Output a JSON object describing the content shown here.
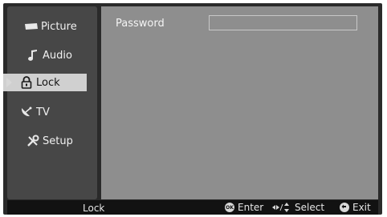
{
  "sidebar": {
    "items": [
      {
        "label": "Picture",
        "icon": "picture-icon"
      },
      {
        "label": "Audio",
        "icon": "music-note-icon"
      },
      {
        "label": "Lock",
        "icon": "padlock-icon",
        "active": true
      },
      {
        "label": "TV",
        "icon": "satellite-dish-icon"
      },
      {
        "label": "Setup",
        "icon": "wrench-screwdriver-icon"
      }
    ]
  },
  "main": {
    "password_label": "Password",
    "password_value": ""
  },
  "bottom_bar": {
    "title": "Lock",
    "enter_icon_text": "OK",
    "enter_label": "Enter",
    "select_label": "Select",
    "exit_label": "Exit"
  },
  "colors": {
    "sidebar_bg": "#474747",
    "main_bg": "#8e8e8e",
    "active_item_bg": "#d0d0d0",
    "bottom_bar_bg": "#121212"
  }
}
